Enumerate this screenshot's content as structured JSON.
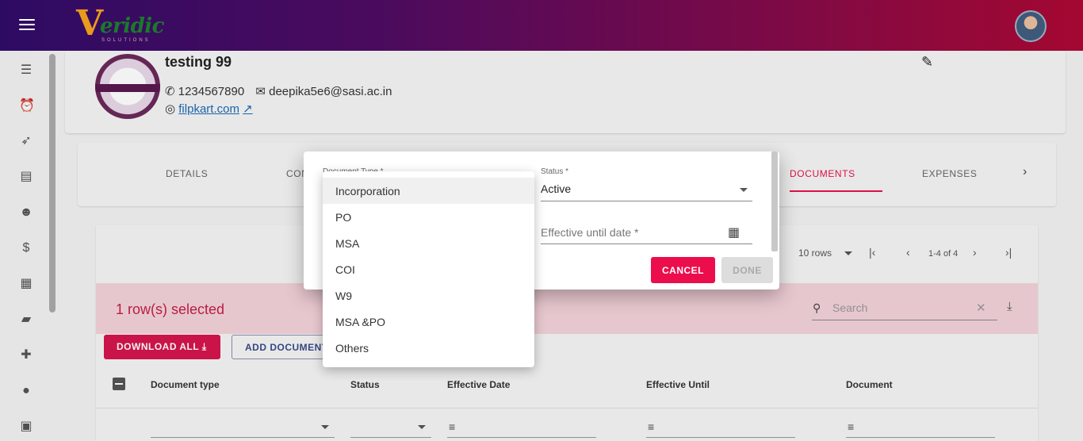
{
  "app": {
    "logo_text": "eridic",
    "logo_letter": "V",
    "logo_tagline": "SOLUTIONS"
  },
  "profile": {
    "name": "testing 99",
    "phone": "1234567890",
    "email": "deepika5e6@sasi.ac.in",
    "website": "filpkart.com"
  },
  "tabs": [
    {
      "label": "DETAILS",
      "active": false
    },
    {
      "label": "CON",
      "active": false
    },
    {
      "label": "DOCUMENTS",
      "active": true
    },
    {
      "label": "EXPENSES",
      "active": false
    }
  ],
  "table": {
    "rows_per_page": "10 rows",
    "range": "1-4 of 4",
    "selected_text": "1 row(s) selected",
    "search_placeholder": "Search",
    "download_all_label": "DOWNLOAD ALL",
    "add_document_label": "ADD DOCUMENT",
    "columns": [
      "Document type",
      "Status",
      "Effective Date",
      "Effective Until",
      "Document"
    ]
  },
  "dialog": {
    "document_type_label": "Document Type *",
    "status_label": "Status *",
    "status_value": "Active",
    "effective_until_placeholder": "Effective until date *",
    "cancel_label": "CANCEL",
    "done_label": "DONE"
  },
  "dropdown": {
    "options": [
      "Incorporation",
      "PO",
      "MSA",
      "COI",
      "W9",
      "MSA &PO",
      "Others"
    ],
    "highlighted": "Incorporation"
  },
  "icons": {
    "sidebar": [
      "checklist-icon",
      "alarm-icon",
      "rocket-icon",
      "list-icon",
      "person-rocket-icon",
      "dollar-icon",
      "document-icon",
      "chat-icon",
      "add-user-icon",
      "group-icon",
      "briefcase-icon"
    ]
  },
  "colors": {
    "accent": "#e8124f",
    "topbar_start": "#2e0b63",
    "topbar_end": "#a30831",
    "selection_bg": "#f4d2da"
  }
}
